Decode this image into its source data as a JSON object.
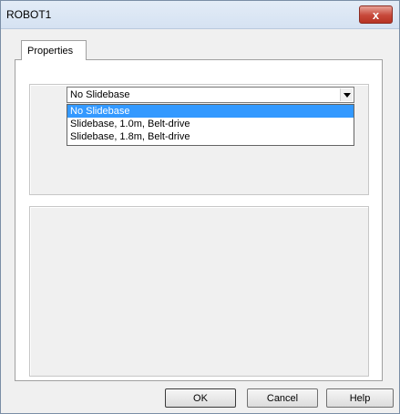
{
  "window": {
    "title": "ROBOT1"
  },
  "titlebar": {
    "close_glyph": "x",
    "close_icon": "close-icon"
  },
  "tabs": [
    {
      "label": "Properties",
      "active": true
    }
  ],
  "slidebase": {
    "selected": "No Slidebase",
    "options": [
      "No Slidebase",
      "Slidebase, 1.0m, Belt-drive",
      "Slidebase, 1.8m, Belt-drive"
    ],
    "highlighted_index": 0
  },
  "buttons": {
    "ok": "OK",
    "cancel": "Cancel",
    "help": "Help"
  },
  "colors": {
    "highlight": "#3399ff",
    "close_button": "#c7483a"
  }
}
